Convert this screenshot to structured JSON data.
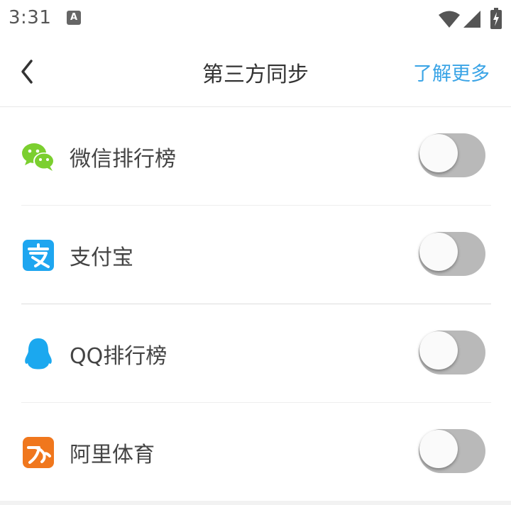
{
  "status_bar": {
    "time": "3:31",
    "notification_icon_letter": "A",
    "icons": [
      "wifi-icon",
      "signal-icon",
      "battery-charging-icon"
    ]
  },
  "header": {
    "back_icon": "chevron-left-icon",
    "title": "第三方同步",
    "action_label": "了解更多",
    "action_color": "#3aa4e6"
  },
  "items": [
    {
      "label": "微信排行榜",
      "icon": "wechat-icon",
      "icon_color": "#7bcf2f",
      "toggle_on": false
    },
    {
      "label": "支付宝",
      "icon": "alipay-icon",
      "icon_color": "#1ea6f0",
      "toggle_on": false
    },
    {
      "label": "QQ排行榜",
      "icon": "qq-penguin-icon",
      "icon_color": "#1ba8ef",
      "toggle_on": false
    },
    {
      "label": "阿里体育",
      "icon": "ali-sports-icon",
      "icon_color": "#f0771d",
      "toggle_on": false
    }
  ]
}
